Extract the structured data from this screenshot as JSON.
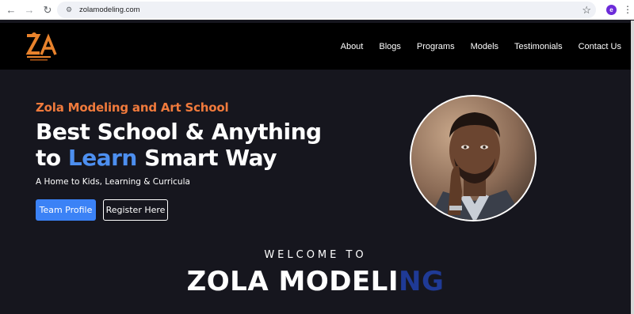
{
  "browser": {
    "url": "zolamodeling.com",
    "profile_initial": "e"
  },
  "header": {
    "logo_text": "ZA",
    "nav": [
      {
        "label": "About"
      },
      {
        "label": "Blogs"
      },
      {
        "label": "Programs"
      },
      {
        "label": "Models"
      },
      {
        "label": "Testimonials"
      },
      {
        "label": "Contact Us"
      }
    ]
  },
  "hero": {
    "eyebrow": "Zola Modeling and Art School",
    "headline_line1": "Best School & Anything",
    "headline_line2_pre": "to ",
    "headline_line2_accent": "Learn",
    "headline_line2_post": " Smart Way",
    "tagline": "A Home to Kids, Learning & Curricula",
    "primary_button": "Team Profile",
    "secondary_button": "Register Here"
  },
  "welcome": {
    "kicker": "WELCOME TO",
    "brand_main": "ZOLA MODELI",
    "brand_tail": "NG"
  },
  "colors": {
    "accent_orange": "#f07a3c",
    "accent_blue": "#4d8ff0",
    "button_blue": "#3b82f6",
    "brand_tail_blue": "#1f3a96",
    "hero_bg": "#16161e"
  }
}
